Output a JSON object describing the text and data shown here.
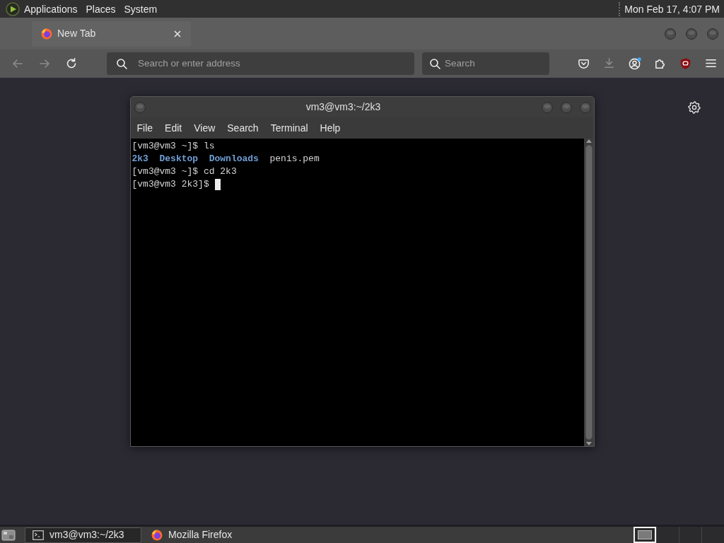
{
  "top_panel": {
    "menus": [
      "Applications",
      "Places",
      "System"
    ],
    "clock": "Mon Feb 17, 4:07 PM"
  },
  "browser": {
    "tabs": [
      {
        "label": "New Tab",
        "selected": true
      }
    ],
    "nav_buttons": [
      {
        "kind": "back",
        "disabled": true
      },
      {
        "kind": "forward",
        "disabled": true
      },
      {
        "kind": "reload",
        "disabled": false
      }
    ],
    "address_bar": {
      "placeholder": "Search or enter address"
    },
    "search_bar": {
      "placeholder": "Search"
    },
    "toolbar_icons": [
      {
        "kind": "pocket",
        "disabled": false,
        "notification": false
      },
      {
        "kind": "download",
        "disabled": true,
        "notification": false
      },
      {
        "kind": "account",
        "disabled": false,
        "notification": true
      },
      {
        "kind": "extensions",
        "disabled": false,
        "notification": false
      },
      {
        "kind": "ublock",
        "disabled": false,
        "notification": false
      },
      {
        "kind": "menu",
        "disabled": false,
        "notification": false
      }
    ]
  },
  "terminal": {
    "title": "vm3@vm3:~/2k3",
    "menus": [
      "File",
      "Edit",
      "View",
      "Search",
      "Terminal",
      "Help"
    ],
    "lines": [
      {
        "kind": "text",
        "text": "[vm3@vm3 ~]$ ls",
        "cursor": false
      },
      {
        "kind": "listing",
        "entries": [
          {
            "name": "2k3",
            "kind": "dir"
          },
          {
            "name": "Desktop",
            "kind": "dir"
          },
          {
            "name": "Downloads",
            "kind": "dir"
          },
          {
            "name": "penis.pem",
            "kind": "file"
          }
        ],
        "cursor": false
      },
      {
        "kind": "text",
        "text": "[vm3@vm3 ~]$ cd 2k3",
        "cursor": false
      },
      {
        "kind": "text",
        "text": "[vm3@vm3 2k3]$",
        "cursor": true
      }
    ]
  },
  "taskbar": {
    "tasks": [
      {
        "label": "vm3@vm3:~/2k3",
        "kind": "terminal",
        "selected": true
      },
      {
        "label": "Mozilla Firefox",
        "kind": "browser",
        "selected": false
      }
    ],
    "workspaces": [
      {
        "selected": true,
        "has_window": true
      },
      {
        "selected": false,
        "has_window": false
      },
      {
        "selected": false,
        "has_window": false
      },
      {
        "selected": false,
        "has_window": false
      }
    ]
  }
}
